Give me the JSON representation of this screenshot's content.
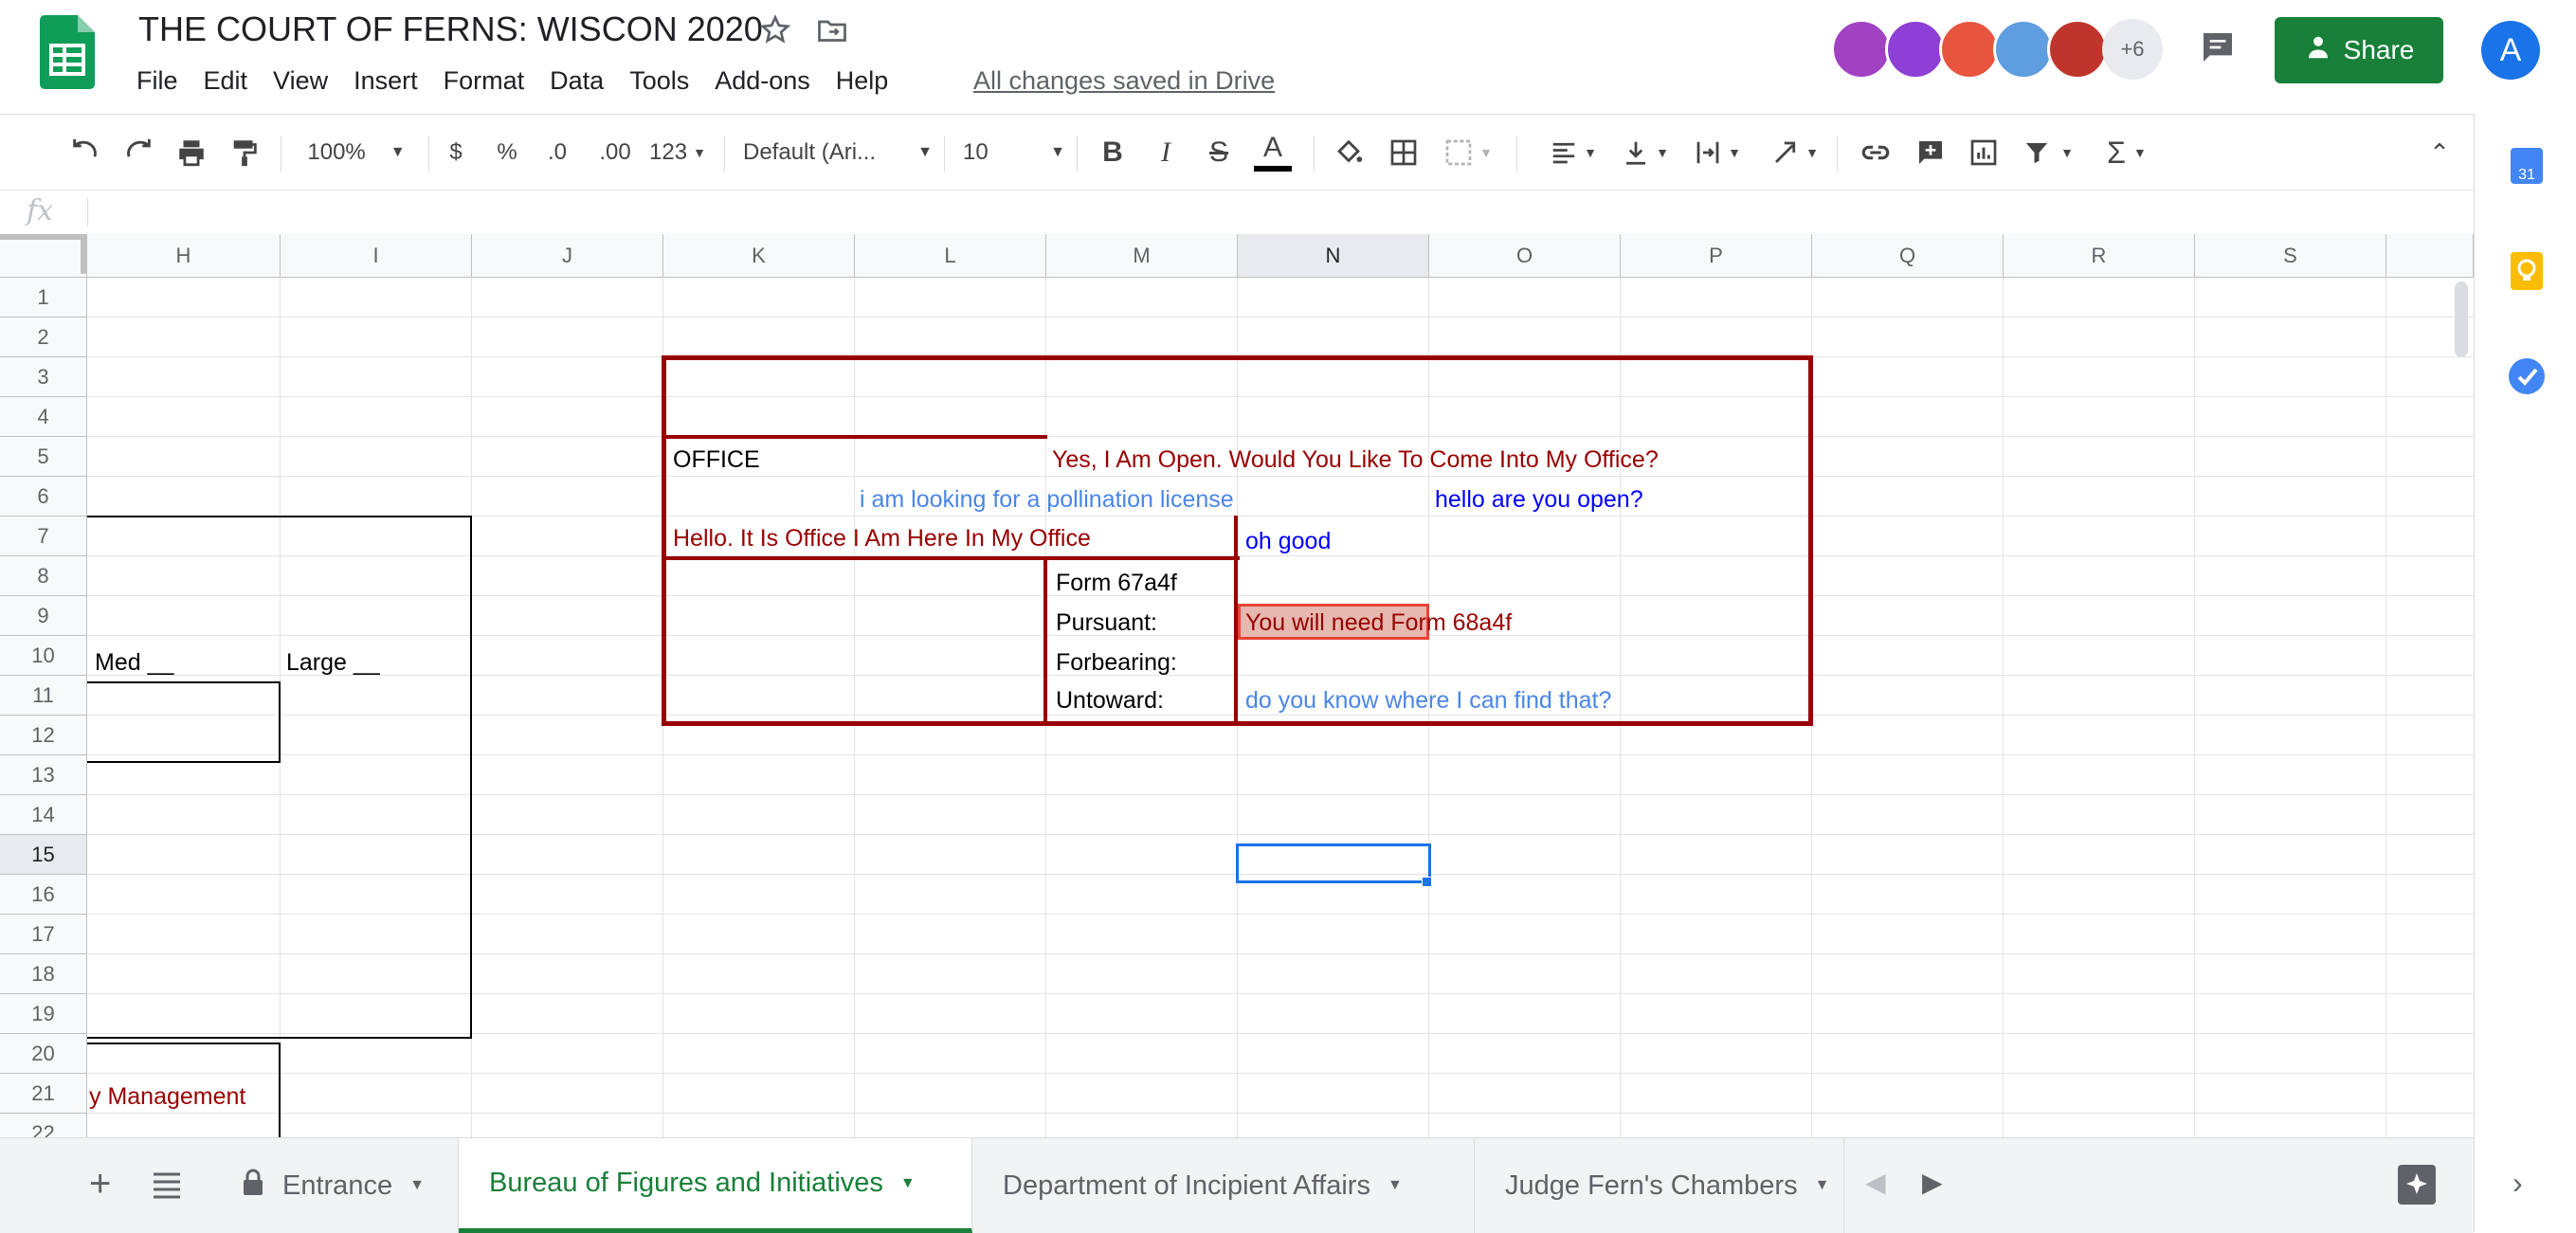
{
  "document": {
    "title": "THE COURT OF FERNS: WISCON 2020",
    "saved_status": "All changes saved in Drive"
  },
  "menu": [
    "File",
    "Edit",
    "View",
    "Insert",
    "Format",
    "Data",
    "Tools",
    "Add-ons",
    "Help"
  ],
  "collaborators": {
    "extra_count": "+6",
    "colors": [
      "#a142c2",
      "#8e3fd6",
      "#e8553f",
      "#5e9de0",
      "#c0352b"
    ]
  },
  "share": {
    "label": "Share"
  },
  "account": {
    "initial": "A",
    "color": "#1a73e8"
  },
  "toolbar": {
    "zoom": "100%",
    "currency": "$",
    "percent": "%",
    "decrease_decimals": ".0",
    "increase_decimals": ".00",
    "more_formats": "123",
    "font": "Default (Ari...",
    "font_size": "10"
  },
  "formula_bar": {
    "label": "fx",
    "value": ""
  },
  "columns": [
    "H",
    "I",
    "J",
    "K",
    "L",
    "M",
    "N",
    "O",
    "P",
    "Q",
    "R",
    "S"
  ],
  "selected_column": "N",
  "rows": [
    "1",
    "2",
    "3",
    "4",
    "5",
    "6",
    "7",
    "8",
    "9",
    "10",
    "11",
    "12",
    "13",
    "14",
    "15",
    "16",
    "17",
    "18",
    "19",
    "20",
    "21",
    "22"
  ],
  "selected_row": "15",
  "cells": {
    "office": "OFFICE",
    "open_reply": "Yes, I Am Open. Would You Like To Come Into My Office?",
    "pollination": "i am looking for a pollination license",
    "hello_open": "hello are you open?",
    "hello_office": "Hello. It Is Office I Am Here In My Office",
    "oh_good": "oh good",
    "form_id": "Form 67a4f",
    "pursuant": "Pursuant:",
    "forbearing": "Forbearing:",
    "untoward": "Untoward:",
    "need_form": "You will need Form 68a4f",
    "where_find": "do you know where I can find that?",
    "med": "Med __",
    "large": "Large __",
    "management": "y Management"
  },
  "colors": {
    "dark_red": "#990000",
    "light_blue": "#4a86e8",
    "blue": "#0000ff",
    "green": "#188038",
    "selection": "#1a73e8"
  },
  "sheets": [
    {
      "label": "Entrance",
      "locked": true
    },
    {
      "label": "Bureau of Figures and Initiatives",
      "active": true
    },
    {
      "label": "Department of Incipient Affairs"
    },
    {
      "label": "Judge Fern's Chambers"
    }
  ]
}
